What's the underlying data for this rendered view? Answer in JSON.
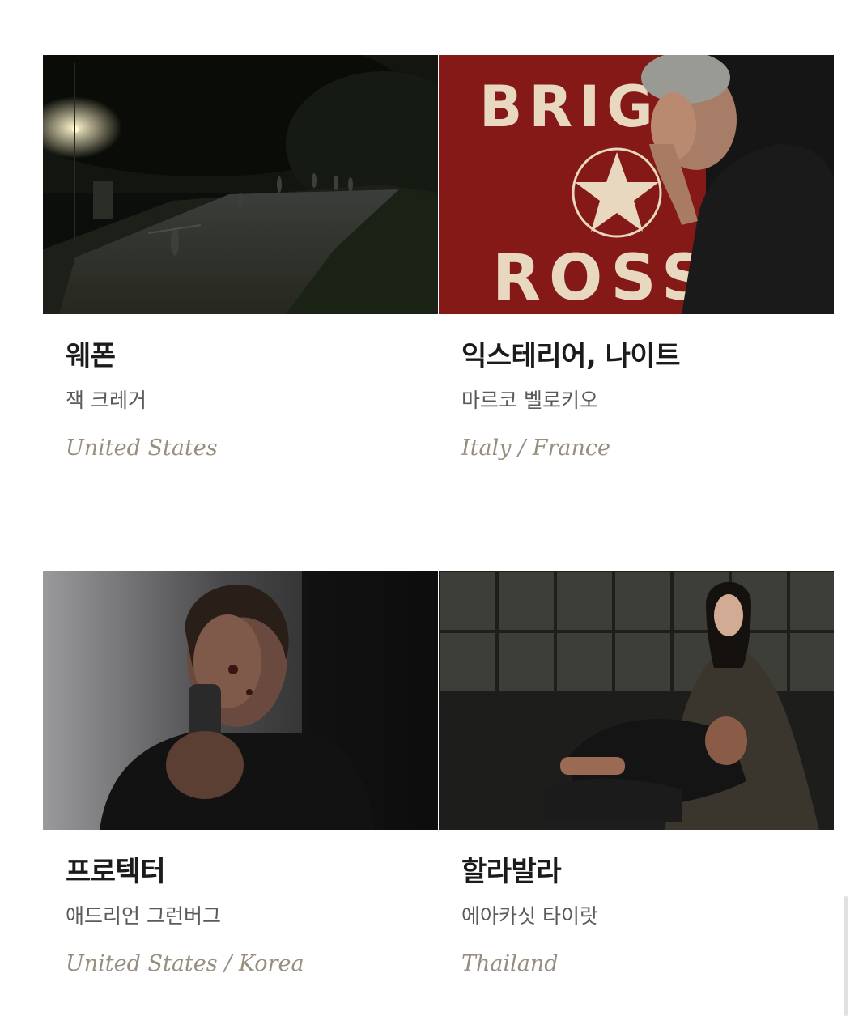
{
  "films": [
    {
      "title": "웨폰",
      "director": "잭 크레거",
      "country": "United States"
    },
    {
      "title": "익스테리어, 나이트",
      "director": "마르코 벨로키오",
      "country": "Italy / France"
    },
    {
      "title": "프로텍터",
      "director": "애드리언 그런버그",
      "country": "United States / Korea"
    },
    {
      "title": "할라발라",
      "director": "에아카싯 타이랏",
      "country": "Thailand"
    }
  ],
  "banner_text": {
    "top": "BRIG",
    "bottom": "ROSS"
  },
  "colors": {
    "title": "#1b1b1b",
    "director": "#5a5a5a",
    "country": "#978e80"
  }
}
